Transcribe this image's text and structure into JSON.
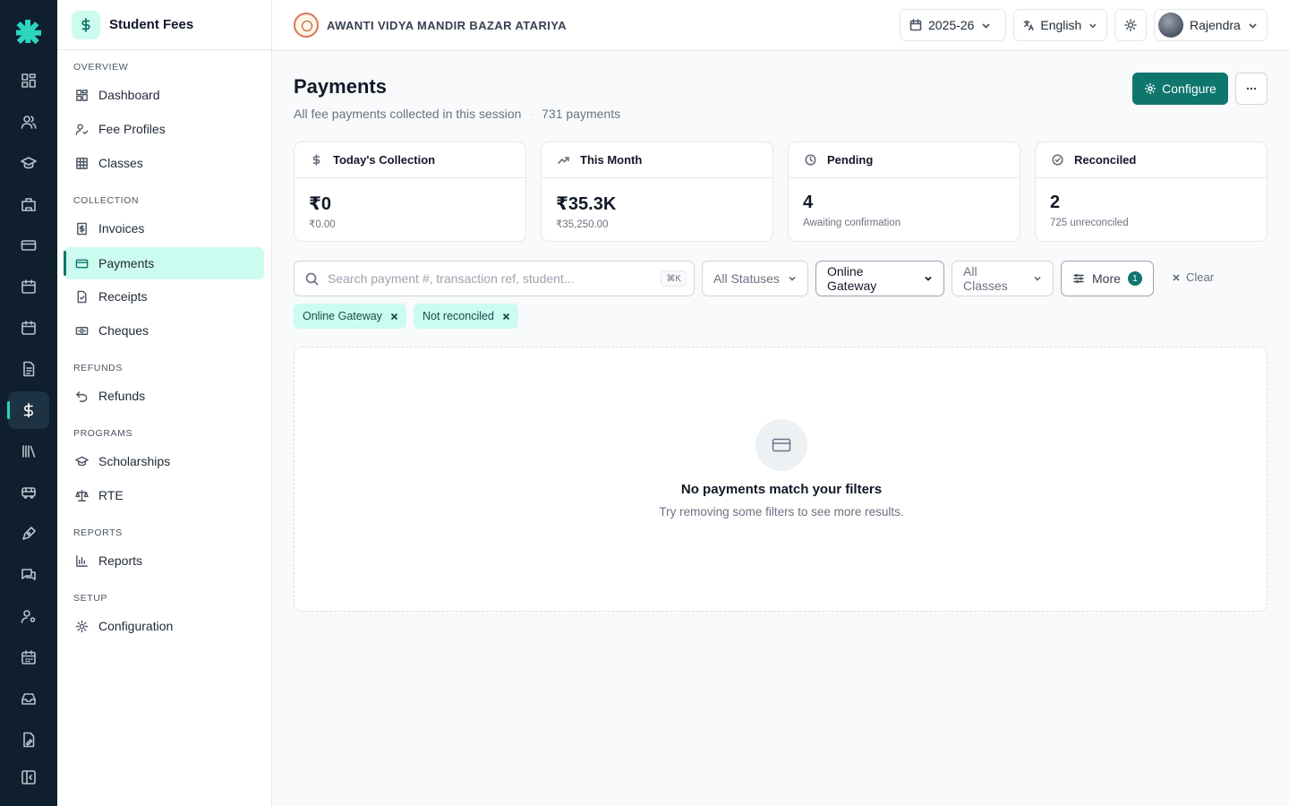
{
  "header": {
    "school_name": "AWANTI VIDYA MANDIR BAZAR ATARIYA",
    "session": "2025-26",
    "language": "English",
    "user": "Rajendra"
  },
  "sidebar": {
    "title": "Student Fees",
    "sections": {
      "overview": "OVERVIEW",
      "collection": "COLLECTION",
      "refunds": "REFUNDS",
      "programs": "PROGRAMS",
      "reports": "REPORTS",
      "setup": "SETUP"
    },
    "items": {
      "dashboard": "Dashboard",
      "fee_profiles": "Fee Profiles",
      "classes": "Classes",
      "invoices": "Invoices",
      "payments": "Payments",
      "receipts": "Receipts",
      "cheques": "Cheques",
      "refunds": "Refunds",
      "scholarships": "Scholarships",
      "rte": "RTE",
      "reports": "Reports",
      "configuration": "Configuration"
    }
  },
  "page": {
    "title": "Payments",
    "subtitle": "All fee payments collected in this session",
    "count": "731 payments",
    "configure_label": "Configure"
  },
  "stats": [
    {
      "label": "Today's Collection",
      "value": "₹0",
      "sub": "₹0.00"
    },
    {
      "label": "This Month",
      "value": "₹35.3K",
      "sub": "₹35,250.00"
    },
    {
      "label": "Pending",
      "value": "4",
      "sub": "Awaiting confirmation"
    },
    {
      "label": "Reconciled",
      "value": "2",
      "sub": "725 unreconciled"
    }
  ],
  "filters": {
    "search_placeholder": "Search payment #, transaction ref, student...",
    "shortcut": "⌘K",
    "status": "All Statuses",
    "method": "Online Gateway",
    "class": "All Classes",
    "more": "More",
    "more_count": "1",
    "clear": "Clear",
    "chips": [
      "Online Gateway",
      "Not reconciled"
    ]
  },
  "empty_state": {
    "title": "No payments match your filters",
    "subtitle": "Try removing some filters to see more results."
  },
  "colors": {
    "rail": "#0f1f2e",
    "accent": "#0f766e",
    "accent_light": "#ccfbef"
  }
}
